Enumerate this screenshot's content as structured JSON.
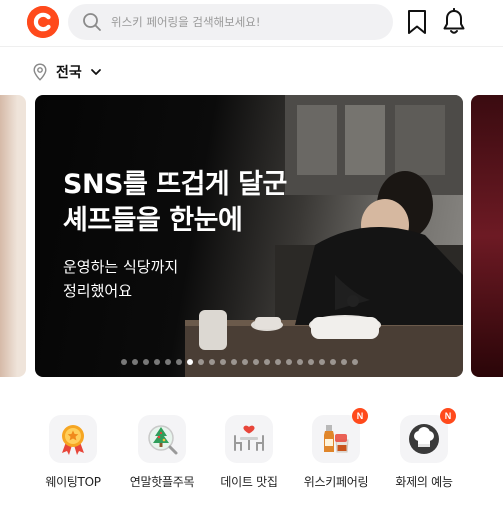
{
  "header": {
    "search_placeholder": "위스키 페어링을 검색해보세요!"
  },
  "location": {
    "label": "전국"
  },
  "banner": {
    "title_line1": "SNS를 뜨겁게 달군",
    "title_line2": "셰프들을 한눈에",
    "subtitle_line1": "운영하는 식당까지",
    "subtitle_line2": "정리했어요",
    "dot_count": 22,
    "active_dot": 6
  },
  "categories": [
    {
      "label": "웨이팅TOP",
      "icon": "medal-icon",
      "badge": ""
    },
    {
      "label": "연말핫플주목",
      "icon": "christmas-tree-icon",
      "badge": ""
    },
    {
      "label": "데이트 맛집",
      "icon": "date-table-icon",
      "badge": ""
    },
    {
      "label": "위스키페어링",
      "icon": "whisky-icon",
      "badge": "N"
    },
    {
      "label": "화제의 예능",
      "icon": "chef-hat-icon",
      "badge": "N"
    }
  ],
  "colors": {
    "brand": "#ff4a1c",
    "search_bg": "#f1f1f3",
    "icon_tile_bg": "#f4f4f6"
  }
}
